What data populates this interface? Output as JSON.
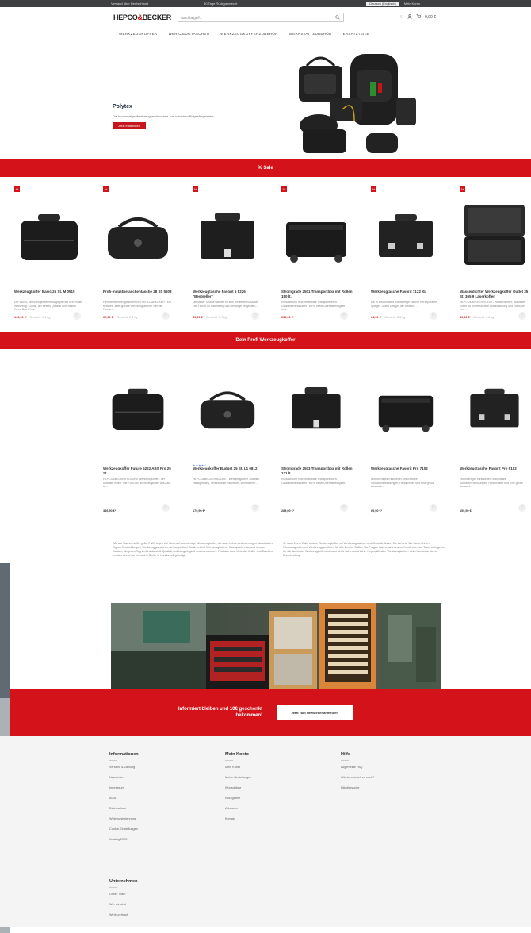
{
  "topbar": {
    "left_text": "Versand über Deutschland",
    "center_text": "30 Tage Rückgaberecht",
    "language": "Deutsch (Englisch)",
    "account": "Mein Konto"
  },
  "header": {
    "logo_main": "HEPCO",
    "logo_amp": "&",
    "logo_tail": "BECKER",
    "search_placeholder": "Suchbegriff...",
    "cart_label": "0,00 €"
  },
  "nav": {
    "items": [
      "WERKZEUGKOFFER",
      "WERKZEUGTASCHEN",
      "WERKZEUGKOFFERZUBEHÖR",
      "WERKSTATTZUBEHÖR",
      "ERSATZTEILE"
    ]
  },
  "hero": {
    "title": "Polytex",
    "subtitle": "Die hochwertige Werkzeugtaschenserie aus robustem Polyestergewebe",
    "button": "Jetzt entdecken"
  },
  "sale_band": {
    "label": "% Sale"
  },
  "sale_products": [
    {
      "badge": "%",
      "name": "Werkzeugkoffer Basic 25 St. M 0515",
      "desc": "Der BASIC Werkzeugkoffer im Bagstyle hält kein Roller Werkzeug. Kunde, der bestes Qualität zum besten Preis. Das Preis...",
      "price": "149,90 €*",
      "unit": "Gewicht: 9,1 kg"
    },
    {
      "badge": "%",
      "name": "Profi-Industrietaschentasche 28 St. 5608",
      "desc": "Flexible Werkzeugtaschen von HEPCO&BECKER - Ein flexibles, aber großes Werkzeugtaschen Set mit Fassen...",
      "price": "67,90 €*",
      "unit": "Gewicht: 2,4 kg"
    },
    {
      "badge": "%",
      "name": "Werkzeugtasche Favorit 5 5226 \"Bestseller\"",
      "desc": "Die ideale Tasche handelt es sich um einen Klassiker. Der Favorit ist hochwertig und formfolge hergestellt...",
      "price": "89,90 €*",
      "unit": "Gewicht: 3,7 kg"
    },
    {
      "badge": "%",
      "name": "Stromgrade 2501 Transportbox mit Rollen 150 lt.",
      "desc": "Robuste und hochbelastbare Transportkisten. Glasfaserverstärktes HDPE bietet Überlastfestigkeit und...",
      "price": "289,00 €*",
      "unit": ""
    },
    {
      "badge": "%",
      "name": "Werkzeugtasche Favorit 7122 XL",
      "desc": "Bei in Deutschland hochwertige Tasche mit separatem Spiegel. Gutes Design, der ideal für...",
      "price": "64,90 €*",
      "unit": "Gewicht: 2,6 kg"
    },
    {
      "badge": "%",
      "name": "Wasserdichter Werkzeugkoffer Outlet 35 St. 365 9 Laserkoffer",
      "desc": "HEPCO&BECKER SOLID - Wasserdichter, stoßfester Koffer für professionelle Aufbewahrung und Transport von...",
      "price": "89,90 €*",
      "unit": "Gewicht: 4,6 kg"
    }
  ],
  "profi_band": {
    "label": "Dein Profi Werkzeugkoffer"
  },
  "profi_products": [
    {
      "name": "Werkzeugkoffer Future 5222 ABS Pro 25 St. L",
      "stars": "",
      "desc": "HEPCO&BECKER FUTURE Werkzeugkoffer - der optimale Koffer. Die FUTURE Werkzeugkoffer aus ABS ist...",
      "price": "349,90 €*"
    },
    {
      "name": "Werkzeugkoffer Budget 25 St. L1 0812",
      "stars": "★★★★☆",
      "desc": "HEPCO&BECKER BUDGET Werkzeugkoffer - stabiler Handgriffsteg, Verbesserter Stauraum, verbesserte...",
      "price": "179,90 €*"
    },
    {
      "name": "Stromgrade 2503 Transportbox mit Rollen 121 lt.",
      "stars": "",
      "desc": "Robuste und hochbelastbare Transportkisten. Glasfaserverstärktes HDPE bietet Überlastfestigkeit...",
      "price": "289,00 €*"
    },
    {
      "name": "Werkzeugtasche Favorit Pro 7102",
      "stars": "",
      "desc": "Hochwertiges Rindsleder, unsichtbare Schraubverbindungen, Handlichkeit und eine große Auswahl...",
      "price": "89,90 €*"
    },
    {
      "name": "Werkzeugtasche Favorit Pro 5102",
      "stars": "",
      "desc": "Hochwertiges Rindsleder, unsichtbare Schraubverbindungen, Handlichkeit und eine große Auswahl...",
      "price": "159,90 €*"
    }
  ],
  "text_block": {
    "left": "Wie auf Sachen sollte gelten? Wir legen viel Wert auf hochwertige Werkzeugkoffer, die auch hohen Anforderungen standhalten. Eigene Entwicklungen, Werkzeuggarnituren mit komplettem Sortiment bei Werkzeugkoffern. Das spricht man und unsere Kunden, die jeden Tag im Einsatz sind. Qualität und Langlebigkeit zeichnen unsere Produkte aus. Viele der Koffer und Taschen werden direkt hier bei uns in Berlin in Handarbeit gefertigt.",
    "right": "Je nach Ihrem Wahl unsere Werkzeugkoffer mit Werkzeugtaschen und Zubehör finden Sie bei uns. Wir bieten Ihnen Werkzeugkoffer, mit Werkzeuggarnituren für alle Berufe. Sollten Sie Fragen haben, sind unsere Kundenservice Team sehr gerne für Sie da. Unser Werkzeugkoffersortiment ist für hohe Ansprüche. Hepco&Becker Werkzeugkoffer - dein Handwerk, deine Entscheidung."
  },
  "newsletter": {
    "text_line1": "Informiert bleiben und 10€ geschenkt",
    "text_line2": "bekommen!",
    "button": "Jetzt zum Newsletter anmelden"
  },
  "footer": {
    "columns": [
      {
        "title": "Informationen",
        "items": [
          "Versand & Zahlung",
          "Newsletter",
          "Impressum",
          "AGB",
          "Datenschutz",
          "Widerrufsbelehrung",
          "Cookie-Einstellungen",
          "Katalog 2023"
        ]
      },
      {
        "title": "Mein Konto",
        "items": [
          "Mein Konto",
          "Meine Bestellungen",
          "Wunschliste",
          "Rückgaben",
          "Adressen",
          "Kontakt"
        ]
      },
      {
        "title": "Hilfe",
        "items": [
          "Allgemeine FAQ",
          "Wie komme ich zu euch?",
          "Händlersuche"
        ]
      },
      {
        "title": "Unternehmen",
        "items": [
          "Unser Team",
          "Wer wir sind",
          "Werksverkauf"
        ]
      }
    ]
  },
  "colors": {
    "brand_red": "#d41219",
    "topbar": "#3d3f41",
    "footer_bg": "#f4f4f4"
  },
  "icons": [
    "search-icon",
    "user-icon",
    "wishlist-icon",
    "cart-icon",
    "heart-icon"
  ]
}
